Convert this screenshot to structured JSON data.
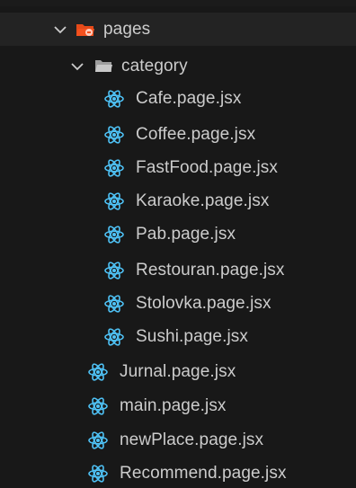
{
  "explorer": {
    "root": {
      "label": "pages",
      "icon": "folder-open-pages-icon",
      "expanded": true
    },
    "category": {
      "label": "category",
      "icon": "folder-open-icon",
      "expanded": true,
      "files": [
        {
          "label": "Cafe.page.jsx",
          "icon": "react-icon"
        },
        {
          "label": "Coffee.page.jsx",
          "icon": "react-icon"
        },
        {
          "label": "FastFood.page.jsx",
          "icon": "react-icon"
        },
        {
          "label": "Karaoke.page.jsx",
          "icon": "react-icon"
        },
        {
          "label": "Pab.page.jsx",
          "icon": "react-icon"
        },
        {
          "label": "Restouran.page.jsx",
          "icon": "react-icon"
        },
        {
          "label": "Stolovka.page.jsx",
          "icon": "react-icon"
        },
        {
          "label": "Sushi.page.jsx",
          "icon": "react-icon"
        }
      ]
    },
    "files": [
      {
        "label": "Jurnal.page.jsx",
        "icon": "react-icon"
      },
      {
        "label": "main.page.jsx",
        "icon": "react-icon"
      },
      {
        "label": "newPlace.page.jsx",
        "icon": "react-icon"
      },
      {
        "label": "Recommend.page.jsx",
        "icon": "react-icon"
      }
    ]
  },
  "colors": {
    "background": "#181818",
    "text": "#cccccc",
    "react": "#4fc3f7",
    "folder_pages": "#f4511e",
    "folder_category": "#c8c8c8",
    "chevron": "#cccccc"
  }
}
